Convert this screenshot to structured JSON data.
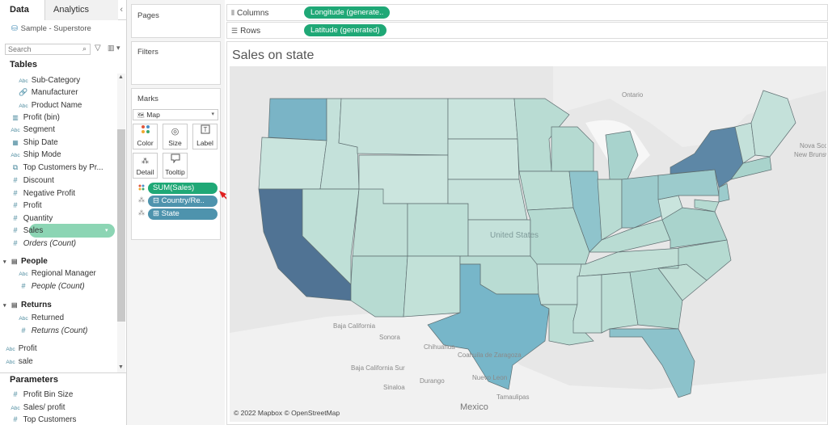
{
  "pane_tabs": {
    "data": "Data",
    "analytics": "Analytics",
    "collapse": "‹"
  },
  "datasource": "Sample - Superstore",
  "search": {
    "placeholder": "Search"
  },
  "tables_header": "Tables",
  "parameters_header": "Parameters",
  "fields": [
    {
      "label": "Sub-Category",
      "type": "Abc",
      "italic": false
    },
    {
      "label": "Manufacturer",
      "type": "link",
      "italic": false
    },
    {
      "label": "Product Name",
      "type": "Abc",
      "italic": false
    },
    {
      "label": "Profit (bin)",
      "type": "bar",
      "italic": false
    },
    {
      "label": "Segment",
      "type": "Abc",
      "italic": false
    },
    {
      "label": "Ship Date",
      "type": "cal",
      "italic": false
    },
    {
      "label": "Ship Mode",
      "type": "Abc",
      "italic": false
    },
    {
      "label": "Top Customers by Pr...",
      "type": "set",
      "italic": false
    },
    {
      "label": "Discount",
      "type": "#",
      "italic": false
    },
    {
      "label": "Negative Profit",
      "type": "#",
      "italic": false
    },
    {
      "label": "Profit",
      "type": "#",
      "italic": false
    },
    {
      "label": "Quantity",
      "type": "#",
      "italic": false
    },
    {
      "label": "Sales",
      "type": "#",
      "italic": false,
      "selected": true
    },
    {
      "label": "Orders (Count)",
      "type": "#",
      "italic": true
    }
  ],
  "groups": {
    "people": {
      "label": "People",
      "fields": [
        "Regional Manager",
        "People (Count)"
      ]
    },
    "returns": {
      "label": "Returns",
      "fields": [
        "Returned",
        "Returns (Count)"
      ]
    }
  },
  "loose_fields": [
    "Profit",
    "sale"
  ],
  "parameters": [
    "Profit Bin Size",
    "Sales/ profit",
    "Top Customers"
  ],
  "cards": {
    "pages": "Pages",
    "filters": "Filters",
    "marks": "Marks"
  },
  "marks": {
    "type": "Map",
    "buttons": {
      "color": "Color",
      "size": "Size",
      "label": "Label",
      "detail": "Detail",
      "tooltip": "Tooltip"
    },
    "pills": [
      "SUM(Sales)",
      "Country/Re..",
      "State"
    ]
  },
  "shelves": {
    "columns_label": "Columns",
    "columns_pill": "Longitude (generate..",
    "rows_label": "Rows",
    "rows_pill": "Latitude (generated)"
  },
  "viz": {
    "title": "Sales on state",
    "attribution": "© 2022 Mapbox © OpenStreetMap",
    "map_labels": [
      "Ontario",
      "Nova Scotia",
      "New Brunswick",
      "United States",
      "Baja California",
      "Sonora",
      "Chihuahua",
      "Coahuila de Zaragoza",
      "Nuevo Leon",
      "Durango",
      "Sinaloa",
      "Baja California Sur",
      "Tamaulipas",
      "Mexico"
    ]
  },
  "colors": {
    "accent_green": "#1fa876",
    "pill_blue": "#4e93ad",
    "selected_field": "#8cd5b4",
    "state_low": "#c4e1da",
    "state_high": "#4f6e91"
  }
}
